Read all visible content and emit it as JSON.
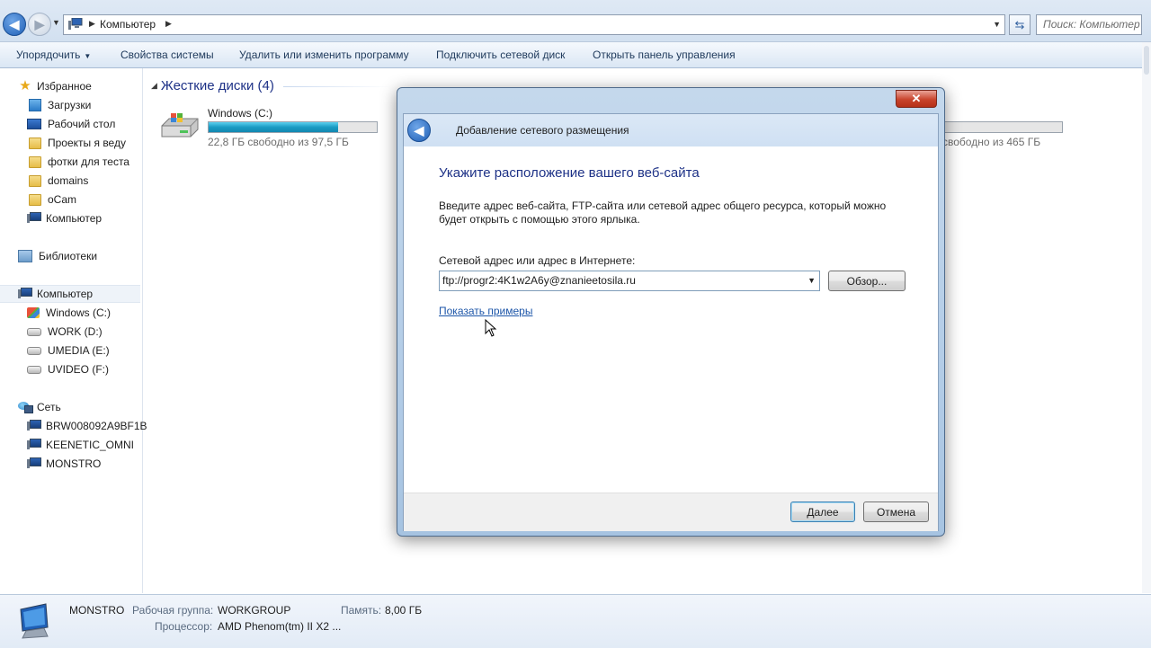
{
  "window": {
    "address": "Компьютер",
    "search_placeholder": "Поиск: Компьютер"
  },
  "toolbar": {
    "organize": "Упорядочить",
    "system_properties": "Свойства системы",
    "uninstall": "Удалить или изменить программу",
    "map_drive": "Подключить сетевой диск",
    "control_panel": "Открыть панель управления"
  },
  "sidebar": {
    "favorites": "Избранное",
    "favorites_items": [
      "Загрузки",
      "Рабочий стол",
      "Проекты я веду",
      "фотки для теста",
      "domains",
      "oCam",
      "Компьютер"
    ],
    "libraries": "Библиотеки",
    "computer": "Компьютер",
    "computer_items": [
      "Windows (C:)",
      "WORK (D:)",
      "UMEDIA (E:)",
      "UVIDEO (F:)"
    ],
    "network": "Сеть",
    "network_items": [
      "BRW008092A9BF1B",
      "KEENETIC_OMNI",
      "MONSTRO"
    ]
  },
  "content": {
    "section_title": "Жесткие диски (4)",
    "drives": [
      {
        "name": "Windows (C:)",
        "free_text": "22,8 ГБ свободно из 97,5 ГБ",
        "used_fraction": 0.77
      },
      {
        "name": "",
        "free_text": "свободно из 465 ГБ",
        "used_fraction": 0.5
      }
    ]
  },
  "details": {
    "computer_name": "MONSTRO",
    "workgroup_label": "Рабочая группа:",
    "workgroup_value": "WORKGROUP",
    "memory_label": "Память:",
    "memory_value": "8,00 ГБ",
    "cpu_label": "Процессор:",
    "cpu_value": "AMD Phenom(tm) II X2 ..."
  },
  "dialog": {
    "close_glyph": "✕",
    "title": "Добавление сетевого размещения",
    "heading": "Укажите расположение вашего веб-сайта",
    "description": "Введите адрес веб-сайта, FTP-сайта или сетевой адрес общего ресурса, который можно будет открыть с помощью этого ярлыка.",
    "field_label": "Сетевой адрес или адрес в Интернете:",
    "field_value": "ftp://progr2:4K1w2A6y@znanieetosila.ru",
    "browse_button": "Обзор...",
    "examples_link": "Показать примеры",
    "next_button": "Далее",
    "cancel_button": "Отмена"
  },
  "colors": {
    "heading_blue": "#1e3287",
    "link_blue": "#1c55a8",
    "drive_bar": "#1a9bc3"
  }
}
